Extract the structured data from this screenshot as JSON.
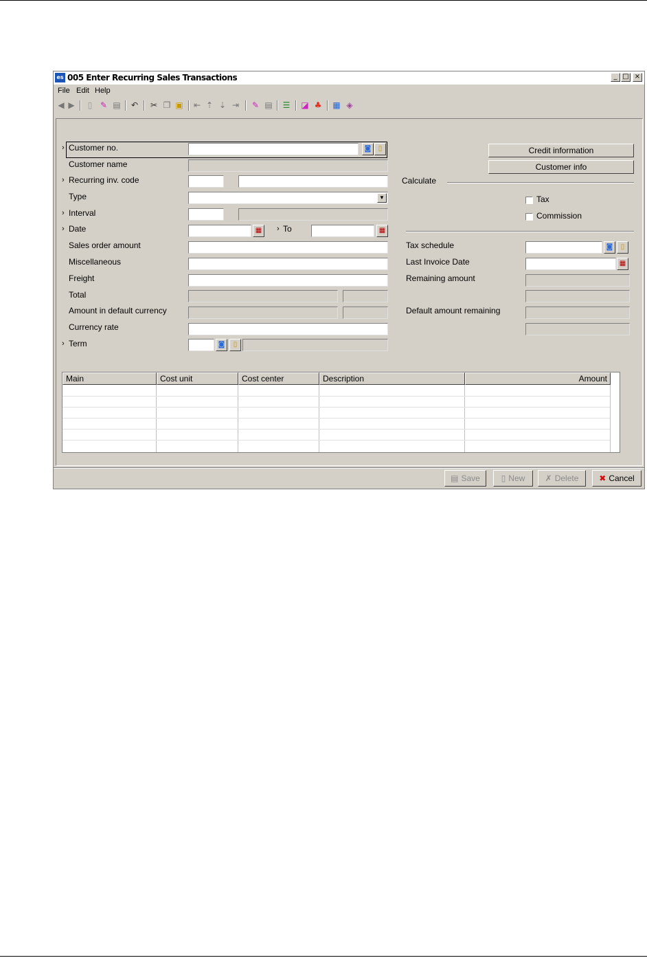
{
  "window": {
    "app_icon": "es",
    "title": "005 Enter Recurring Sales Transactions",
    "controls": {
      "minimize": "_",
      "maximize": "□",
      "close": "×"
    }
  },
  "menu": [
    {
      "label": "File"
    },
    {
      "label": "Edit"
    },
    {
      "label": "Help"
    }
  ],
  "toolbar_icons": [
    "back-icon",
    "forward-icon",
    "new-doc-icon",
    "edit-icon",
    "save-icon",
    "undo-icon",
    "cut-icon",
    "copy-icon",
    "paste-icon",
    "first-record-icon",
    "previous-record-icon",
    "next-record-icon",
    "last-record-icon",
    "edit-record-icon",
    "save-record-icon",
    "list-icon",
    "color-icon",
    "chart-icon",
    "calculator-icon",
    "book-icon"
  ],
  "form": {
    "customer_no": {
      "label": "Customer no.",
      "value": ""
    },
    "customer_name": {
      "label": "Customer name",
      "value": ""
    },
    "recurring_inv_code": {
      "label": "Recurring inv. code",
      "code": "",
      "description": ""
    },
    "type": {
      "label": "Type",
      "value": ""
    },
    "interval": {
      "label": "Interval",
      "value": "",
      "description": ""
    },
    "date": {
      "label": "Date",
      "from": "",
      "to_label": "To",
      "to": ""
    },
    "sales_order_amount": {
      "label": "Sales order amount",
      "value": ""
    },
    "miscellaneous": {
      "label": "Miscellaneous",
      "value": ""
    },
    "freight": {
      "label": "Freight",
      "value": ""
    },
    "total": {
      "label": "Total",
      "value": "",
      "currency": ""
    },
    "amount_default_currency": {
      "label": "Amount in default currency",
      "value": "",
      "currency": ""
    },
    "currency_rate": {
      "label": "Currency rate",
      "value": ""
    },
    "term": {
      "label": "Term",
      "code": "",
      "description": ""
    }
  },
  "right": {
    "credit_information_button": "Credit information",
    "customer_info_button": "Customer info",
    "calculate_label": "Calculate",
    "tax": {
      "label": "Tax",
      "checked": false
    },
    "commission": {
      "label": "Commission",
      "checked": false
    },
    "tax_schedule": {
      "label": "Tax schedule",
      "value": ""
    },
    "last_invoice_date": {
      "label": "Last Invoice Date",
      "value": ""
    },
    "remaining_amount": {
      "label": "Remaining amount",
      "value": "",
      "value2": ""
    },
    "default_amount_remaining": {
      "label": "Default amount remaining",
      "value": "",
      "value2": ""
    }
  },
  "grid": {
    "columns": [
      "Main",
      "Cost unit",
      "Cost center",
      "Description",
      "Amount"
    ],
    "rows": [
      [],
      [],
      [],
      [],
      [],
      []
    ]
  },
  "footer": {
    "save": "Save",
    "new": "New",
    "delete": "Delete",
    "cancel": "Cancel"
  }
}
